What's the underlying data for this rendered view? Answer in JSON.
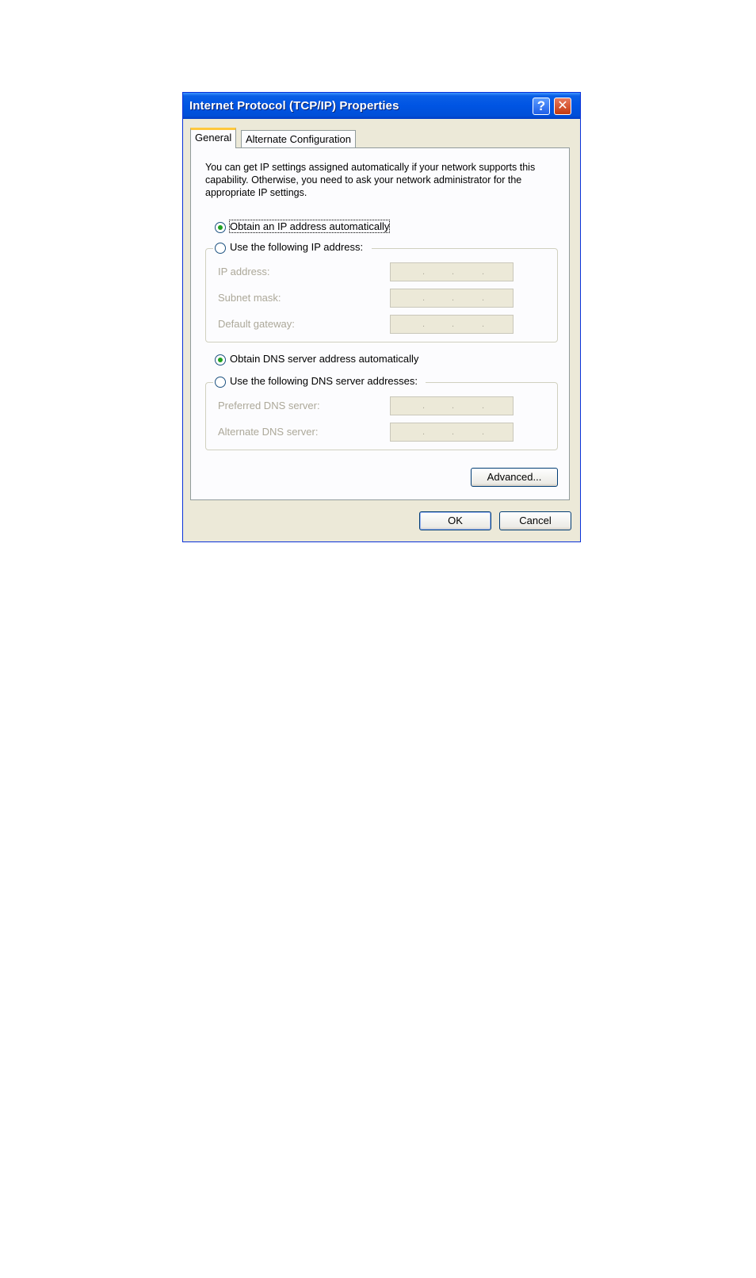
{
  "window": {
    "title": "Internet Protocol (TCP/IP) Properties",
    "help_glyph": "?",
    "close_glyph": "✕"
  },
  "tabs": [
    {
      "label": "General",
      "selected": true
    },
    {
      "label": "Alternate Configuration",
      "selected": false
    }
  ],
  "description": "You can get IP settings assigned automatically if your network supports this capability. Otherwise, you need to ask your network administrator for the appropriate IP settings.",
  "ip_options": {
    "auto": {
      "label": "Obtain an IP address automatically",
      "checked": true
    },
    "manual": {
      "label": "Use the following IP address:",
      "checked": false
    }
  },
  "ip_fields": {
    "ip_address": {
      "label": "IP address:",
      "value": ". . ."
    },
    "subnet_mask": {
      "label": "Subnet mask:",
      "value": ". . ."
    },
    "default_gateway": {
      "label": "Default gateway:",
      "value": ". . ."
    }
  },
  "dns_options": {
    "auto": {
      "label": "Obtain DNS server address automatically",
      "checked": true
    },
    "manual": {
      "label": "Use the following DNS server addresses:",
      "checked": false
    }
  },
  "dns_fields": {
    "preferred": {
      "label": "Preferred DNS server:",
      "value": ". . ."
    },
    "alternate": {
      "label": "Alternate DNS server:",
      "value": ". . ."
    }
  },
  "buttons": {
    "advanced": "Advanced...",
    "ok": "OK",
    "cancel": "Cancel"
  },
  "colors": {
    "titlebar": "#0054e3",
    "dialog_bg": "#ece9d8",
    "radio_dot": "#21a121",
    "tab_highlight": "#ffc83c"
  }
}
